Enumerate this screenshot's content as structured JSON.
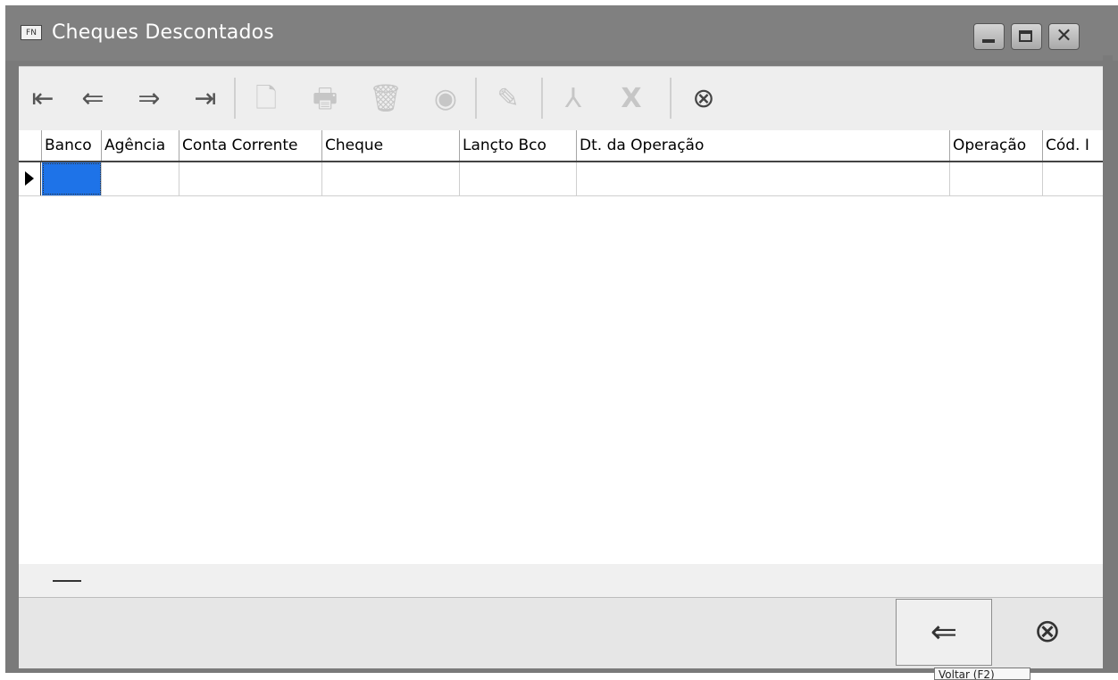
{
  "window": {
    "app_icon_text": "FN",
    "title": "Cheques Descontados",
    "controls": {
      "minimize": "minimize",
      "maximize": "maximize",
      "close": "✕"
    }
  },
  "toolbar": {
    "first": "⇤",
    "prev": "⇐",
    "next": "⇒",
    "last": "⇥",
    "new": "🗋",
    "print": "🖶",
    "delete": "🗑",
    "view": "◉",
    "edit": "✎",
    "pdf": "⅄",
    "excel": "X",
    "cancel": "⊗"
  },
  "grid": {
    "columns": [
      "Banco",
      "Agência",
      "Conta Corrente",
      "Cheque",
      "Lançto Bco",
      "Dt. da Operação",
      "Operação",
      "Cód. I"
    ],
    "rows": [
      [
        "",
        "",
        "",
        "",
        "",
        "",
        "",
        ""
      ]
    ]
  },
  "footer": {
    "back": "⇐",
    "close": "⊗",
    "tooltip": "Voltar (F2)"
  }
}
